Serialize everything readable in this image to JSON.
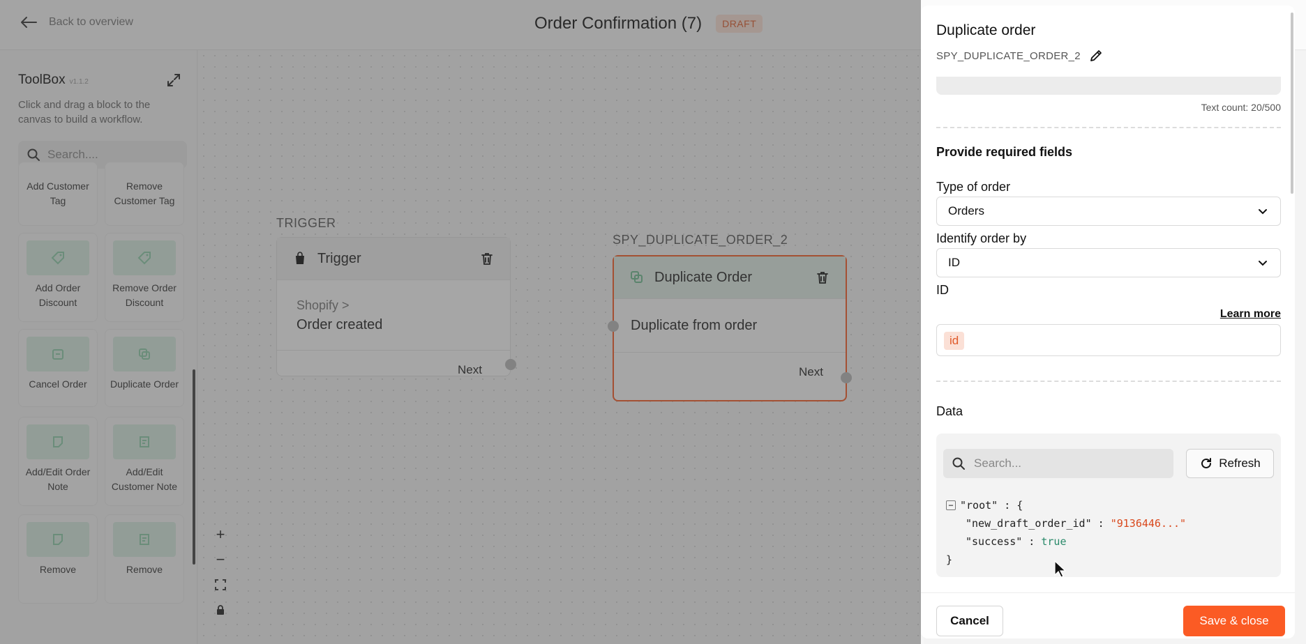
{
  "header": {
    "back_label": "Back to overview",
    "title": "Order Confirmation (7)",
    "status_badge": "DRAFT"
  },
  "toolbox": {
    "title": "ToolBox",
    "version": "v1.1.2",
    "description": "Click and drag a block to the canvas to build a workflow.",
    "search_placeholder": "Search....",
    "blocks": [
      {
        "label": "Add Customer Tag",
        "icon": "tag-plus-icon"
      },
      {
        "label": "Remove Customer Tag",
        "icon": "tag-minus-icon"
      },
      {
        "label": "Add Order Discount",
        "icon": "discount-tag-icon"
      },
      {
        "label": "Remove Order Discount",
        "icon": "discount-tag-remove-icon"
      },
      {
        "label": "Cancel Order",
        "icon": "cancel-order-icon"
      },
      {
        "label": "Duplicate Order",
        "icon": "duplicate-icon"
      },
      {
        "label": "Add/Edit Order Note",
        "icon": "note-icon"
      },
      {
        "label": "Add/Edit Customer Note",
        "icon": "customer-note-icon"
      },
      {
        "label": "Remove",
        "icon": "note-remove-icon"
      },
      {
        "label": "Remove",
        "icon": "customer-note-remove-icon"
      }
    ]
  },
  "canvas": {
    "trigger_node": {
      "section_label": "TRIGGER",
      "title": "Trigger",
      "source": "Shopify >",
      "event": "Order created",
      "next_label": "Next"
    },
    "action_node": {
      "section_label": "SPY_DUPLICATE_ORDER_2",
      "title": "Duplicate Order",
      "body": "Duplicate from order",
      "next_label": "Next"
    },
    "zoom_controls": [
      "zoom-in",
      "zoom-out",
      "fit-view",
      "lock"
    ]
  },
  "panel": {
    "title": "Duplicate order",
    "identifier": "SPY_DUPLICATE_ORDER_2",
    "text_count": "Text count: 20/500",
    "required_heading": "Provide required fields",
    "type_of_order": {
      "label": "Type of order",
      "value": "Orders"
    },
    "identify_by": {
      "label": "Identify order by",
      "value": "ID"
    },
    "id_field": {
      "label": "ID",
      "learn_more": "Learn more",
      "chip": "id"
    },
    "data": {
      "label": "Data",
      "search_placeholder": "Search...",
      "refresh_label": "Refresh",
      "root_key": "\"root\" : {",
      "entries": [
        {
          "key": "\"new_draft_order_id\" : ",
          "value": "\"9136446...\""
        },
        {
          "key": "\"success\" : ",
          "value": "true"
        }
      ],
      "close_brace": "}"
    },
    "footer": {
      "cancel_label": "Cancel",
      "save_label": "Save & close"
    }
  },
  "colors": {
    "accent": "#fb5b24",
    "draft_badge_bg": "#fde2d6",
    "draft_badge_text": "#e05a2a",
    "block_icon_bg": "#d8eee2",
    "json_string": "#d9481c",
    "json_bool": "#2a8a6a"
  }
}
